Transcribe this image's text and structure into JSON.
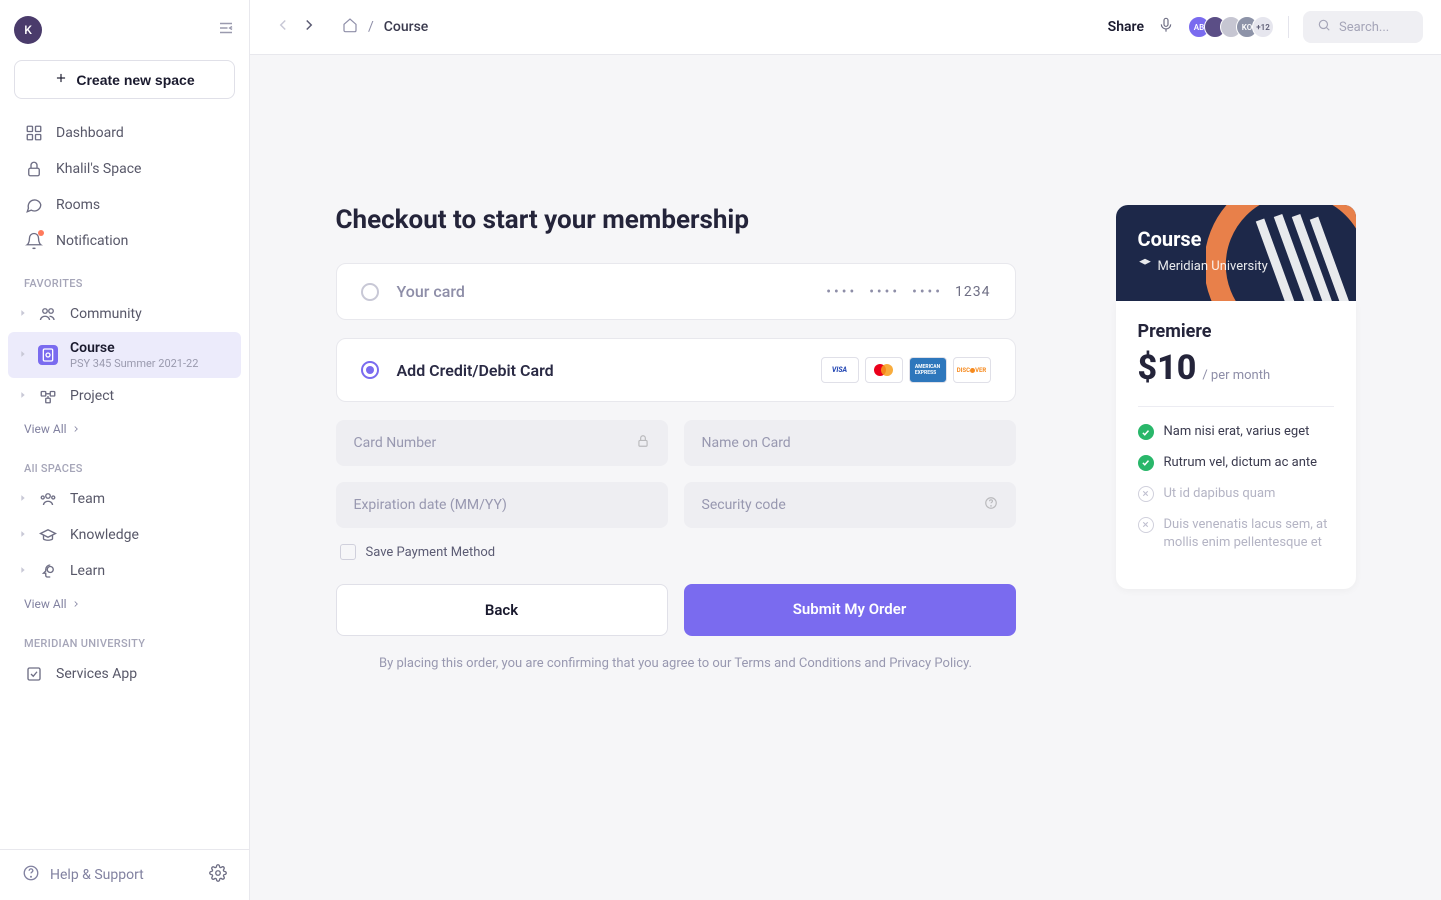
{
  "sidebar": {
    "user_initial": "K",
    "create_space_label": "Create new space",
    "main_nav": [
      {
        "label": "Dashboard",
        "icon": "grid"
      },
      {
        "label": "Khalil's Space",
        "icon": "lock"
      },
      {
        "label": "Rooms",
        "icon": "chat"
      },
      {
        "label": "Notification",
        "icon": "bell"
      }
    ],
    "favorites_label": "FAVORITES",
    "favorites": [
      {
        "label": "Community",
        "icon": "people"
      },
      {
        "label": "Course",
        "sub": "PSY 345 Summer 2021-22",
        "icon": "course",
        "active": true
      },
      {
        "label": "Project",
        "icon": "project"
      }
    ],
    "view_all_label": "View All",
    "allspaces_label": "All SPACES",
    "allspaces": [
      {
        "label": "Team",
        "icon": "team"
      },
      {
        "label": "Knowledge",
        "icon": "cap"
      },
      {
        "label": "Learn",
        "icon": "head"
      }
    ],
    "meridian_label": "MERIDIAN UNIVERSITY",
    "meridian_items": [
      {
        "label": "Services App",
        "icon": "checkbox"
      }
    ],
    "help_label": "Help & Support"
  },
  "topbar": {
    "breadcrumb_current": "Course",
    "share_label": "Share",
    "avatars": [
      {
        "text": "AB",
        "bg": "#7a6bef"
      },
      {
        "text": "",
        "bg": "#5b4e86",
        "img": true
      },
      {
        "text": "",
        "bg": "#c6c6d2",
        "img": true
      },
      {
        "text": "KO",
        "bg": "#8d93a8"
      }
    ],
    "avatar_more": "+12",
    "search_placeholder": "Search..."
  },
  "checkout": {
    "title": "Checkout to start your membership",
    "existing_card_label": "Your card",
    "existing_card_last4": "1234",
    "add_card_label": "Add Credit/Debit Card",
    "card_number_placeholder": "Card Number",
    "name_placeholder": "Name on Card",
    "expiry_placeholder": "Expiration date (MM/YY)",
    "cvv_placeholder": "Security code",
    "save_label": "Save Payment Method",
    "back_label": "Back",
    "submit_label": "Submit My Order",
    "disclaimer": "By placing this order, you are confirming that you agree to our Terms and Conditions and Privacy Policy."
  },
  "plan": {
    "header_title": "Course",
    "header_sub": "Meridian University",
    "tier": "Premiere",
    "amount": "$10",
    "period": "/ per month",
    "features": [
      {
        "text": "Nam nisi erat, varius eget",
        "ok": true
      },
      {
        "text": "Rutrum vel, dictum ac ante",
        "ok": true
      },
      {
        "text": "Ut id dapibus quam",
        "ok": false
      },
      {
        "text": "Duis venenatis lacus sem, at mollis enim pellentesque et",
        "ok": false
      }
    ]
  }
}
